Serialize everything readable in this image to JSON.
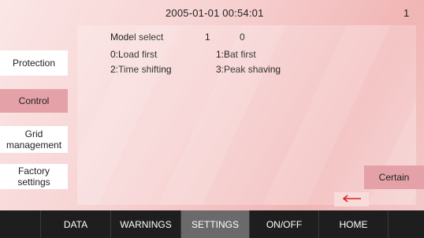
{
  "header": {
    "datetime": "2005-01-01 00:54:01",
    "page_number": "1"
  },
  "sidebar": {
    "protection": "Protection",
    "control": "Control",
    "grid_management": "Grid management",
    "factory_settings": "Factory settings"
  },
  "main": {
    "model_select_label": "Model select",
    "model_select_value1": "1",
    "model_select_value2": "0",
    "options": [
      "0:Load first",
      "1:Bat first",
      "2:Time shifting",
      "3:Peak shaving"
    ]
  },
  "actions": {
    "certain": "Certain"
  },
  "nav": {
    "tabs": [
      "",
      "DATA",
      "WARNINGS",
      "SETTINGS",
      "ON/OFF",
      "HOME",
      ""
    ],
    "active": "SETTINGS"
  },
  "colors": {
    "accent": "#e4a2a8",
    "back_arrow": "#e02020",
    "navbar": "#1e1e1e",
    "active_tab": "#6a6a6a"
  }
}
